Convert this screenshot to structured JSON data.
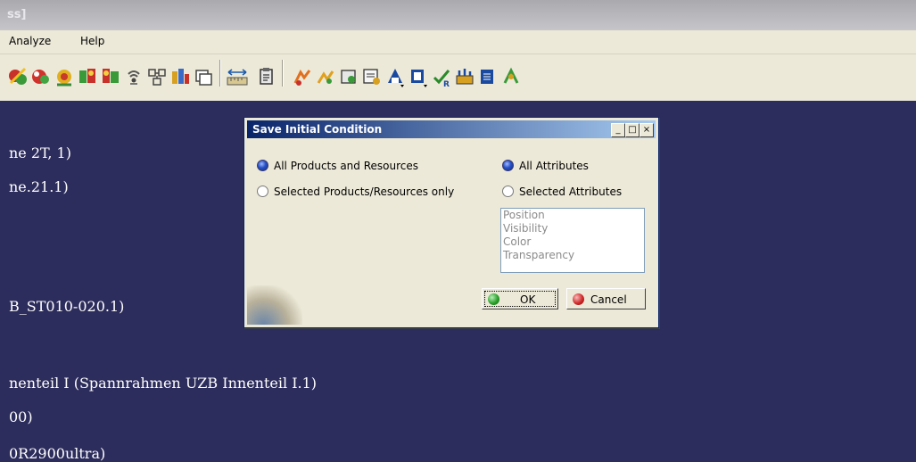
{
  "window": {
    "title_fragment": "ss]"
  },
  "menu": {
    "items": [
      "Analyze",
      "Help"
    ]
  },
  "toolbar": {
    "icons": [
      "sim-icon-1",
      "sim-icon-2",
      "sim-icon-3",
      "sim-icon-4",
      "sim-icon-5",
      "sensor-icon",
      "network-icon",
      "resource-icon",
      "window-icon",
      "measure-icon",
      "clipboard-icon",
      "analyze-icon-1",
      "analyze-icon-2",
      "analyze-icon-3",
      "analyze-icon-4",
      "analyze-icon-5",
      "analyze-icon-6",
      "analyze-icon-7",
      "analyze-icon-8",
      "analyze-icon-9",
      "analyze-icon-10"
    ]
  },
  "tree": {
    "lines": [
      "ne 2T, 1)",
      "ne.21.1)",
      "B_ST010-020.1)",
      "nenteil I (Spannrahmen UZB Innenteil I.1)",
      "00)",
      "0R2900ultra)"
    ]
  },
  "dialog": {
    "title": "Save Initial Condition",
    "buttons": {
      "minimize": "_",
      "maximize": "□",
      "close": "×"
    },
    "products": {
      "all": "All Products and Resources",
      "selected": "Selected Products/Resources only",
      "value": "all"
    },
    "attributes": {
      "all": "All Attributes",
      "selected": "Selected Attributes",
      "value": "all",
      "list": [
        "Position",
        "Visibility",
        "Color",
        "Transparency"
      ]
    },
    "ok_label": "OK",
    "cancel_label": "Cancel"
  },
  "colors": {
    "workspace": "#2d2d5d",
    "dialog": "#ece9d8",
    "titlebar_start": "#0a246a",
    "titlebar_end": "#a6caf0"
  }
}
